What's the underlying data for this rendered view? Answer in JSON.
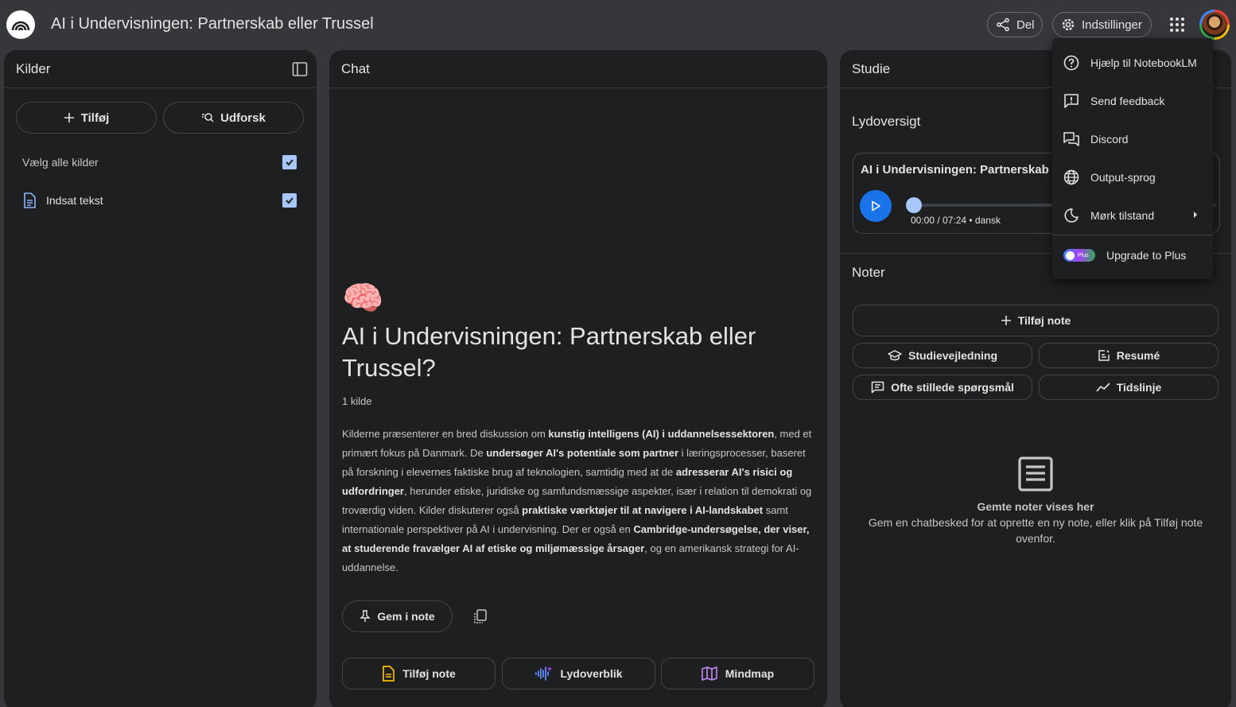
{
  "header": {
    "title": "AI i Undervisningen: Partnerskab eller Trussel",
    "share_label": "Del",
    "settings_label": "Indstillinger"
  },
  "sources": {
    "title": "Kilder",
    "add_label": "Tilføj",
    "explore_label": "Udforsk",
    "select_all_label": "Vælg alle kilder",
    "items": [
      {
        "label": "Indsat tekst"
      }
    ]
  },
  "chat": {
    "title": "Chat",
    "emoji": "🧠",
    "heading": "AI i Undervisningen: Partnerskab eller Trussel?",
    "source_count": "1 kilde",
    "summary_parts": [
      {
        "text": "Kilderne præsenterer en bred diskussion om ",
        "bold": false
      },
      {
        "text": "kunstig intelligens (AI) i uddannelsessektoren",
        "bold": true
      },
      {
        "text": ", med et primært fokus på Danmark. De ",
        "bold": false
      },
      {
        "text": "undersøger AI's potentiale som partner",
        "bold": true
      },
      {
        "text": " i læringsprocesser, baseret på forskning i elevernes faktiske brug af teknologien, samtidig med at de ",
        "bold": false
      },
      {
        "text": "adresserar AI's risici og udfordringer",
        "bold": true
      },
      {
        "text": ", herunder etiske, juridiske og samfundsmæssige aspekter, især i relation til demokrati og troværdig viden. Kilder diskuterer også ",
        "bold": false
      },
      {
        "text": "praktiske værktøjer til at navigere i AI-landskabet",
        "bold": true
      },
      {
        "text": " samt internationale perspektiver på AI i undervisning. Der er også en ",
        "bold": false
      },
      {
        "text": "Cambridge-undersøgelse, der viser, at studerende fravælger AI af etiske og miljømæssige årsager",
        "bold": true
      },
      {
        "text": ", og en amerikansk strategi for AI-uddannelse.",
        "bold": false
      }
    ],
    "save_note_label": "Gem i note",
    "actions": [
      {
        "label": "Tilføj note",
        "icon": "document-icon"
      },
      {
        "label": "Lydoverblik",
        "icon": "audio-wave-icon"
      },
      {
        "label": "Mindmap",
        "icon": "map-icon"
      }
    ]
  },
  "studio": {
    "title": "Studie",
    "audio_section_title": "Lydoversigt",
    "audio_title": "AI i Undervisningen: Partnerskab",
    "audio_time": "00:00 / 07:24 • dansk",
    "notes_title": "Noter",
    "add_note_label": "Tilføj note",
    "note_buttons": [
      {
        "label": "Studievejledning",
        "icon": "graduation-cap-icon"
      },
      {
        "label": "Resumé",
        "icon": "summary-icon"
      },
      {
        "label": "Ofte stillede spørgsmål",
        "icon": "faq-icon"
      },
      {
        "label": "Tidslinje",
        "icon": "timeline-icon"
      }
    ],
    "empty_title": "Gemte noter vises her",
    "empty_text": "Gem en chatbesked for at oprette en ny note, eller klik på Tilføj note ovenfor."
  },
  "settings_menu": {
    "items": [
      {
        "label": "Hjælp til NotebookLM",
        "icon": "help-icon"
      },
      {
        "label": "Send feedback",
        "icon": "feedback-icon"
      },
      {
        "label": "Discord",
        "icon": "discord-icon"
      },
      {
        "label": "Output-sprog",
        "icon": "globe-icon"
      },
      {
        "label": "Mørk tilstand",
        "icon": "moon-icon"
      }
    ],
    "upgrade_label": "Upgrade to Plus",
    "plus_badge": "Plus"
  },
  "colors": {
    "accent": "#1a73e8",
    "checkbox": "#a8c7fa",
    "panel_bg": "#1e1f20",
    "page_bg": "#36373b"
  }
}
